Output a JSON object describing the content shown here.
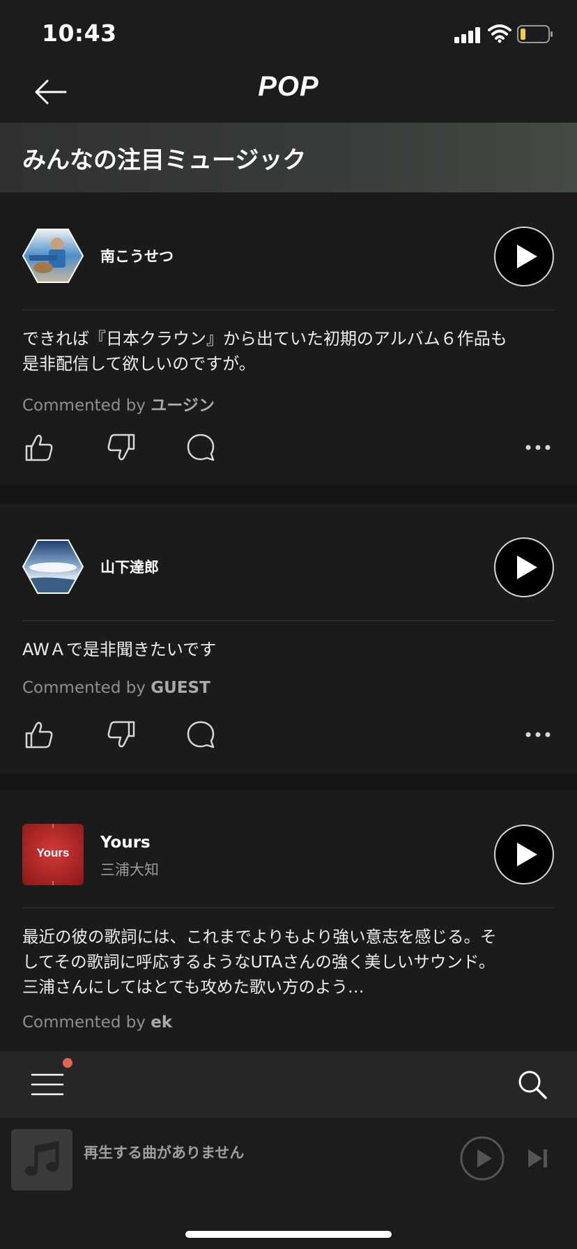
{
  "status_bar": {
    "time": "10:43"
  },
  "nav": {
    "title": "POP"
  },
  "section": {
    "title": "みんなの注目ミュージック"
  },
  "cards": [
    {
      "artist": "南こうせつ",
      "comment_lines": [
        "できれば『日本クラウン』から出ていた初期のアルバム６作品も",
        "是非配信して欲しいのですが。"
      ],
      "commented_by_label": "Commented by",
      "commenter": "ユージン"
    },
    {
      "artist": "山下達郎",
      "comment_lines": [
        "AWＡで是非聞きたいです"
      ],
      "commented_by_label": "Commented by",
      "commenter": "GUEST"
    },
    {
      "track": "Yours",
      "artist": "三浦大知",
      "artwork_text": "Yours",
      "comment_lines": [
        "最近の彼の歌詞には、これまでよりもより強い意志を感じる。そ",
        "してその歌詞に呼応するようなUTAさんの強く美しいサウンド。",
        "三浦さんにしてはとても攻めた歌い方のよう…"
      ],
      "commented_by_label": "Commented by",
      "commenter": "ek"
    }
  ],
  "player": {
    "now_playing_text": "再生する曲がありません"
  },
  "colors": {
    "background": "#141414",
    "card": "#1b1b1b",
    "notification": "#e06650"
  }
}
